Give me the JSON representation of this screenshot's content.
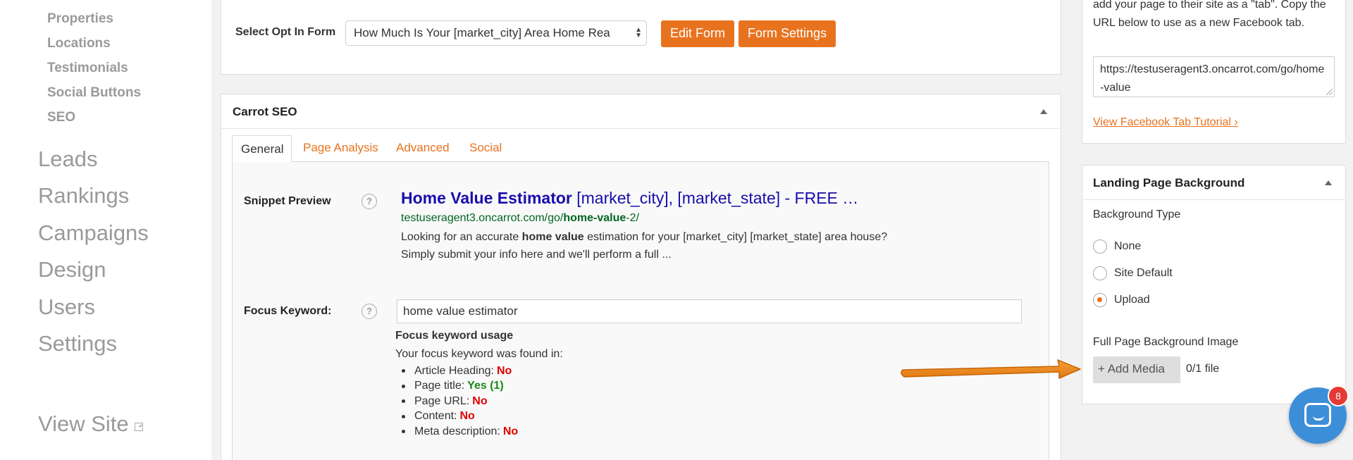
{
  "sidebar": {
    "sub_items": [
      {
        "label": "Properties"
      },
      {
        "label": "Locations"
      },
      {
        "label": "Testimonials"
      },
      {
        "label": "Social Buttons"
      },
      {
        "label": "SEO"
      }
    ],
    "main_items": [
      {
        "label": "Leads"
      },
      {
        "label": "Rankings"
      },
      {
        "label": "Campaigns"
      },
      {
        "label": "Design"
      },
      {
        "label": "Users"
      },
      {
        "label": "Settings"
      }
    ],
    "view_site": "View Site"
  },
  "optin": {
    "label": "Select Opt In Form",
    "selected_value": "How Much Is Your [market_city] Area Home Rea",
    "edit_button": "Edit Form",
    "settings_button": "Form Settings"
  },
  "seo": {
    "title": "Carrot SEO",
    "tabs": [
      {
        "label": "General",
        "active": true
      },
      {
        "label": "Page Analysis",
        "active": false
      },
      {
        "label": "Advanced",
        "active": false
      },
      {
        "label": "Social",
        "active": false
      }
    ],
    "snippet_label": "Snippet Preview",
    "snippet": {
      "title_bold": "Home Value Estimator",
      "title_rest": " [market_city], [market_state] - FREE …",
      "url_prefix": "testuseragent3.oncarrot.com/go/",
      "url_bold": "home-value",
      "url_suffix": "-2/",
      "desc_1": "Looking for an accurate ",
      "desc_bold": "home value",
      "desc_2": " estimation for your [market_city] [market_state] area house? Simply submit your info here and we'll perform a full ..."
    },
    "focus_label": "Focus Keyword:",
    "focus_value": "home value estimator",
    "usage_title": "Focus keyword usage",
    "usage_found": "Your focus keyword was found in:",
    "usage_items": [
      {
        "label": "Article Heading:",
        "value": "No",
        "status": "no"
      },
      {
        "label": "Page title:",
        "value": "Yes (1)",
        "status": "yes"
      },
      {
        "label": "Page URL:",
        "value": "No",
        "status": "no"
      },
      {
        "label": "Content:",
        "value": "No",
        "status": "no"
      },
      {
        "label": "Meta description:",
        "value": "No",
        "status": "no"
      }
    ]
  },
  "facebook": {
    "text": "add your page to their site as a \"tab\". Copy the URL below to use as a new Facebook tab.",
    "url": "https://testuseragent3.oncarrot.com/go/home-value",
    "tutorial_link": "View Facebook Tab Tutorial ›"
  },
  "landing_bg": {
    "title": "Landing Page Background",
    "type_label": "Background Type",
    "options": [
      {
        "label": "None",
        "checked": false
      },
      {
        "label": "Site Default",
        "checked": false
      },
      {
        "label": "Upload",
        "checked": true
      }
    ],
    "image_label": "Full Page Background Image",
    "add_media": "+ Add Media",
    "file_count": "0/1 file"
  },
  "chat": {
    "badge_count": "8"
  },
  "colors": {
    "accent": "#e8731f",
    "link_blue": "#1a0dab",
    "url_green": "#006621",
    "status_no": "#e00000",
    "status_yes": "#1a8a1a",
    "chat_blue": "#3d8ed8"
  }
}
